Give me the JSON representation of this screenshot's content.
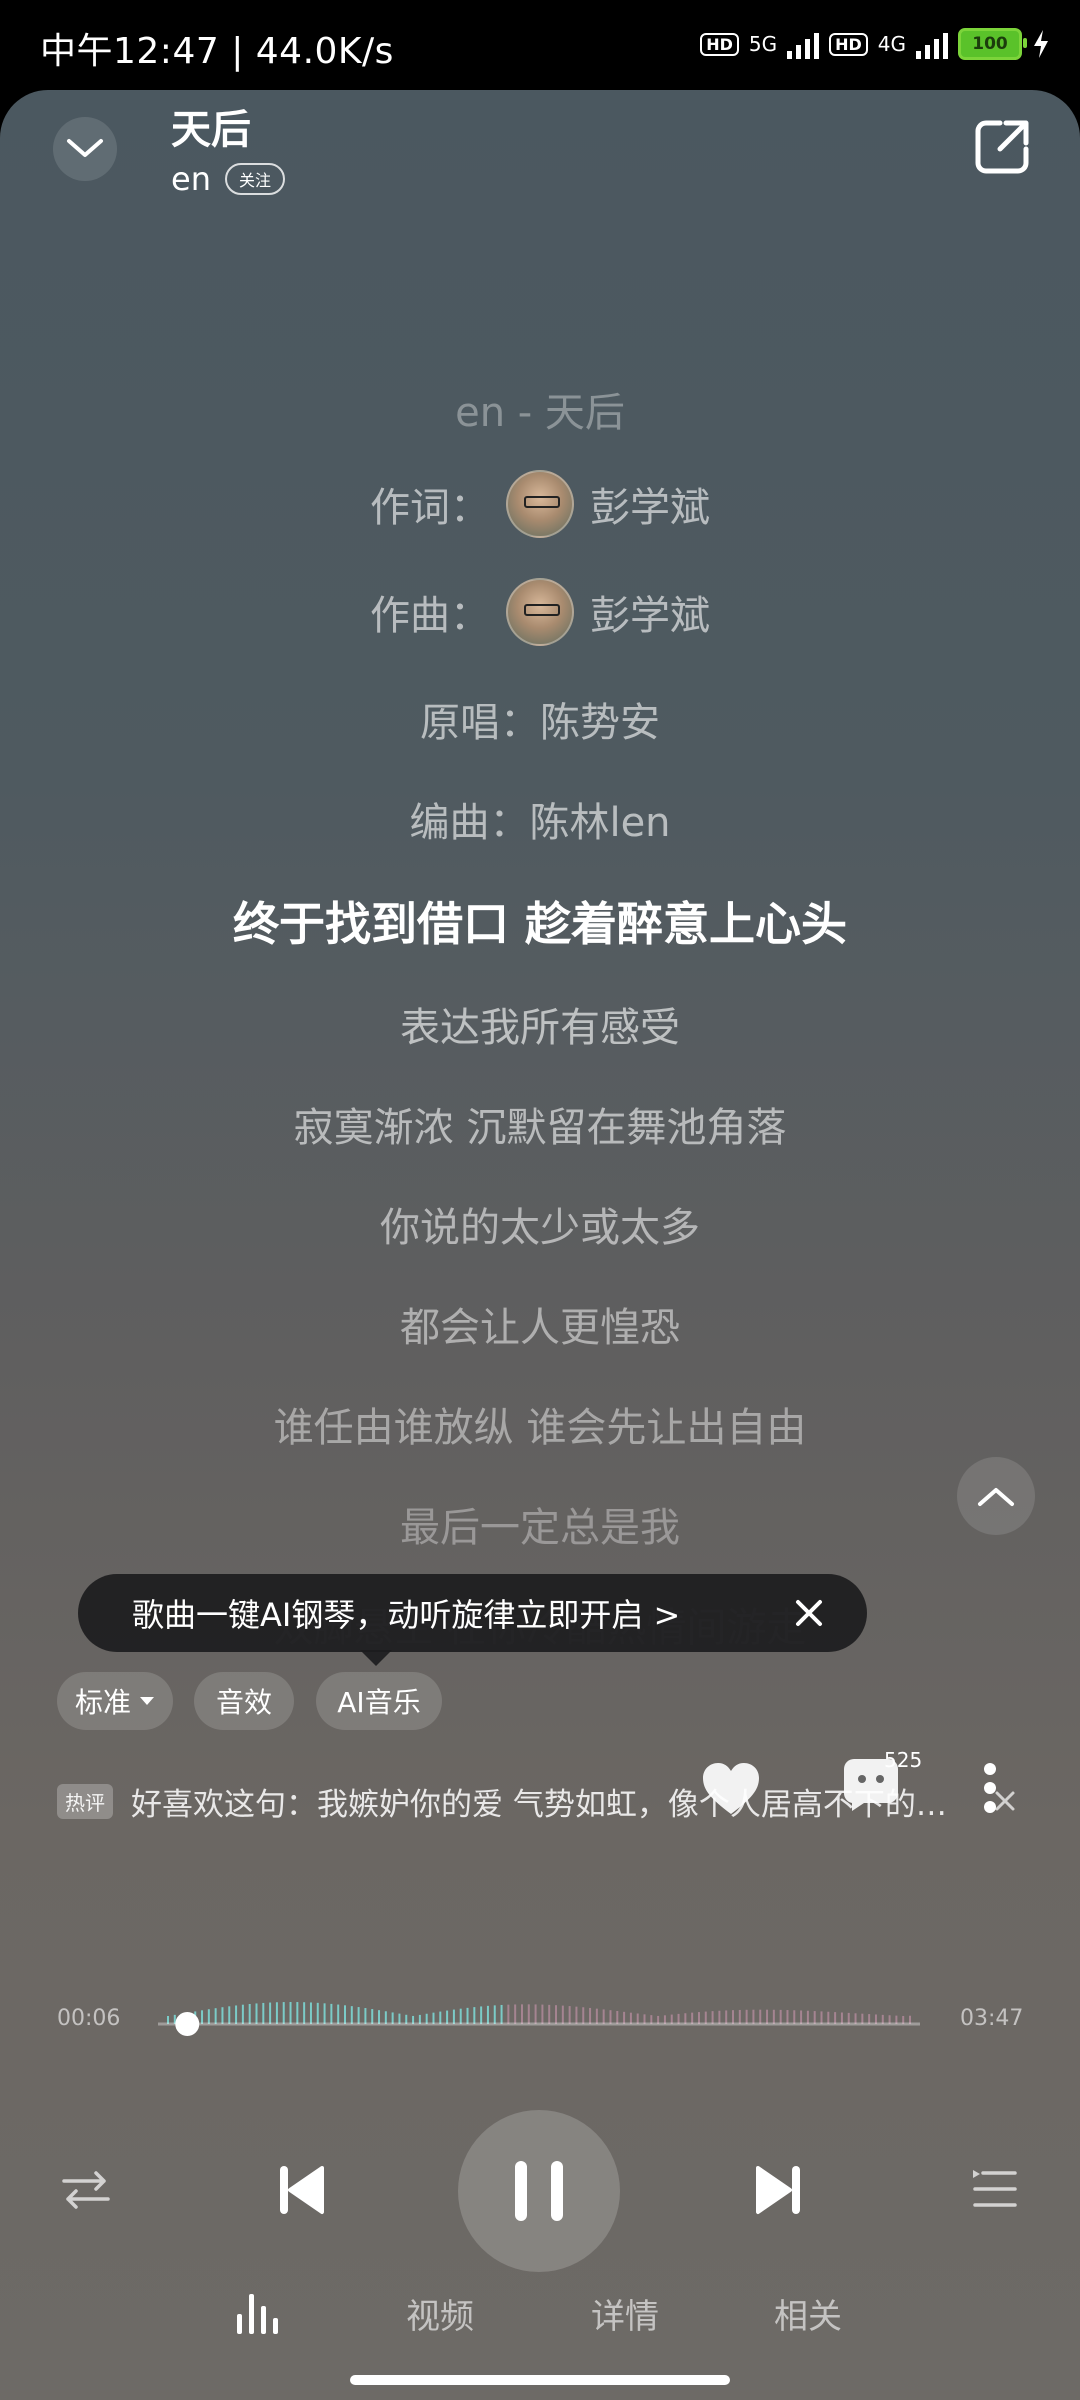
{
  "status_bar": {
    "time_speed": "中午12:47 | 44.0K/s",
    "net1": "5G",
    "net2": "4G",
    "hd": "HD",
    "battery": "100"
  },
  "header": {
    "title": "天后",
    "artist": "en",
    "follow": "关注"
  },
  "lyrics": {
    "heading": "en - 天后",
    "credits": [
      {
        "label": "作词：",
        "name": "彭学斌"
      },
      {
        "label": "作曲：",
        "name": "彭学斌"
      }
    ],
    "original": "原唱：陈势安",
    "arranger": "编曲：陈林len",
    "current": "终于找到借口 趁着醉意上心头",
    "lines": [
      "表达我所有感受",
      "寂寞渐浓 沉默留在舞池角落",
      "你说的太少或太多",
      "都会让人更惶恐",
      "谁任由谁放纵 谁会先让出自由",
      "最后一定总是我",
      "双脚悬空 在你冷酷热情间游走"
    ]
  },
  "tooltip": {
    "text": "歌曲一键AI钢琴，动听旋律立即开启 >"
  },
  "controls": {
    "quality": "标准",
    "effects": "音效",
    "ai_music": "AI音乐",
    "comment_count": "525"
  },
  "hot_comment": {
    "badge": "热评",
    "text": "好喜欢这句：我嫉妒你的爱 气势如虹，像个人居高不下的…"
  },
  "progress": {
    "elapsed": "00:06",
    "total": "03:47",
    "fraction": 0.026
  },
  "tabs": {
    "video": "视频",
    "details": "详情",
    "related": "相关"
  },
  "colors": {
    "played_wave": "#7fe3e0",
    "remaining_wave": "#d59ab7"
  }
}
